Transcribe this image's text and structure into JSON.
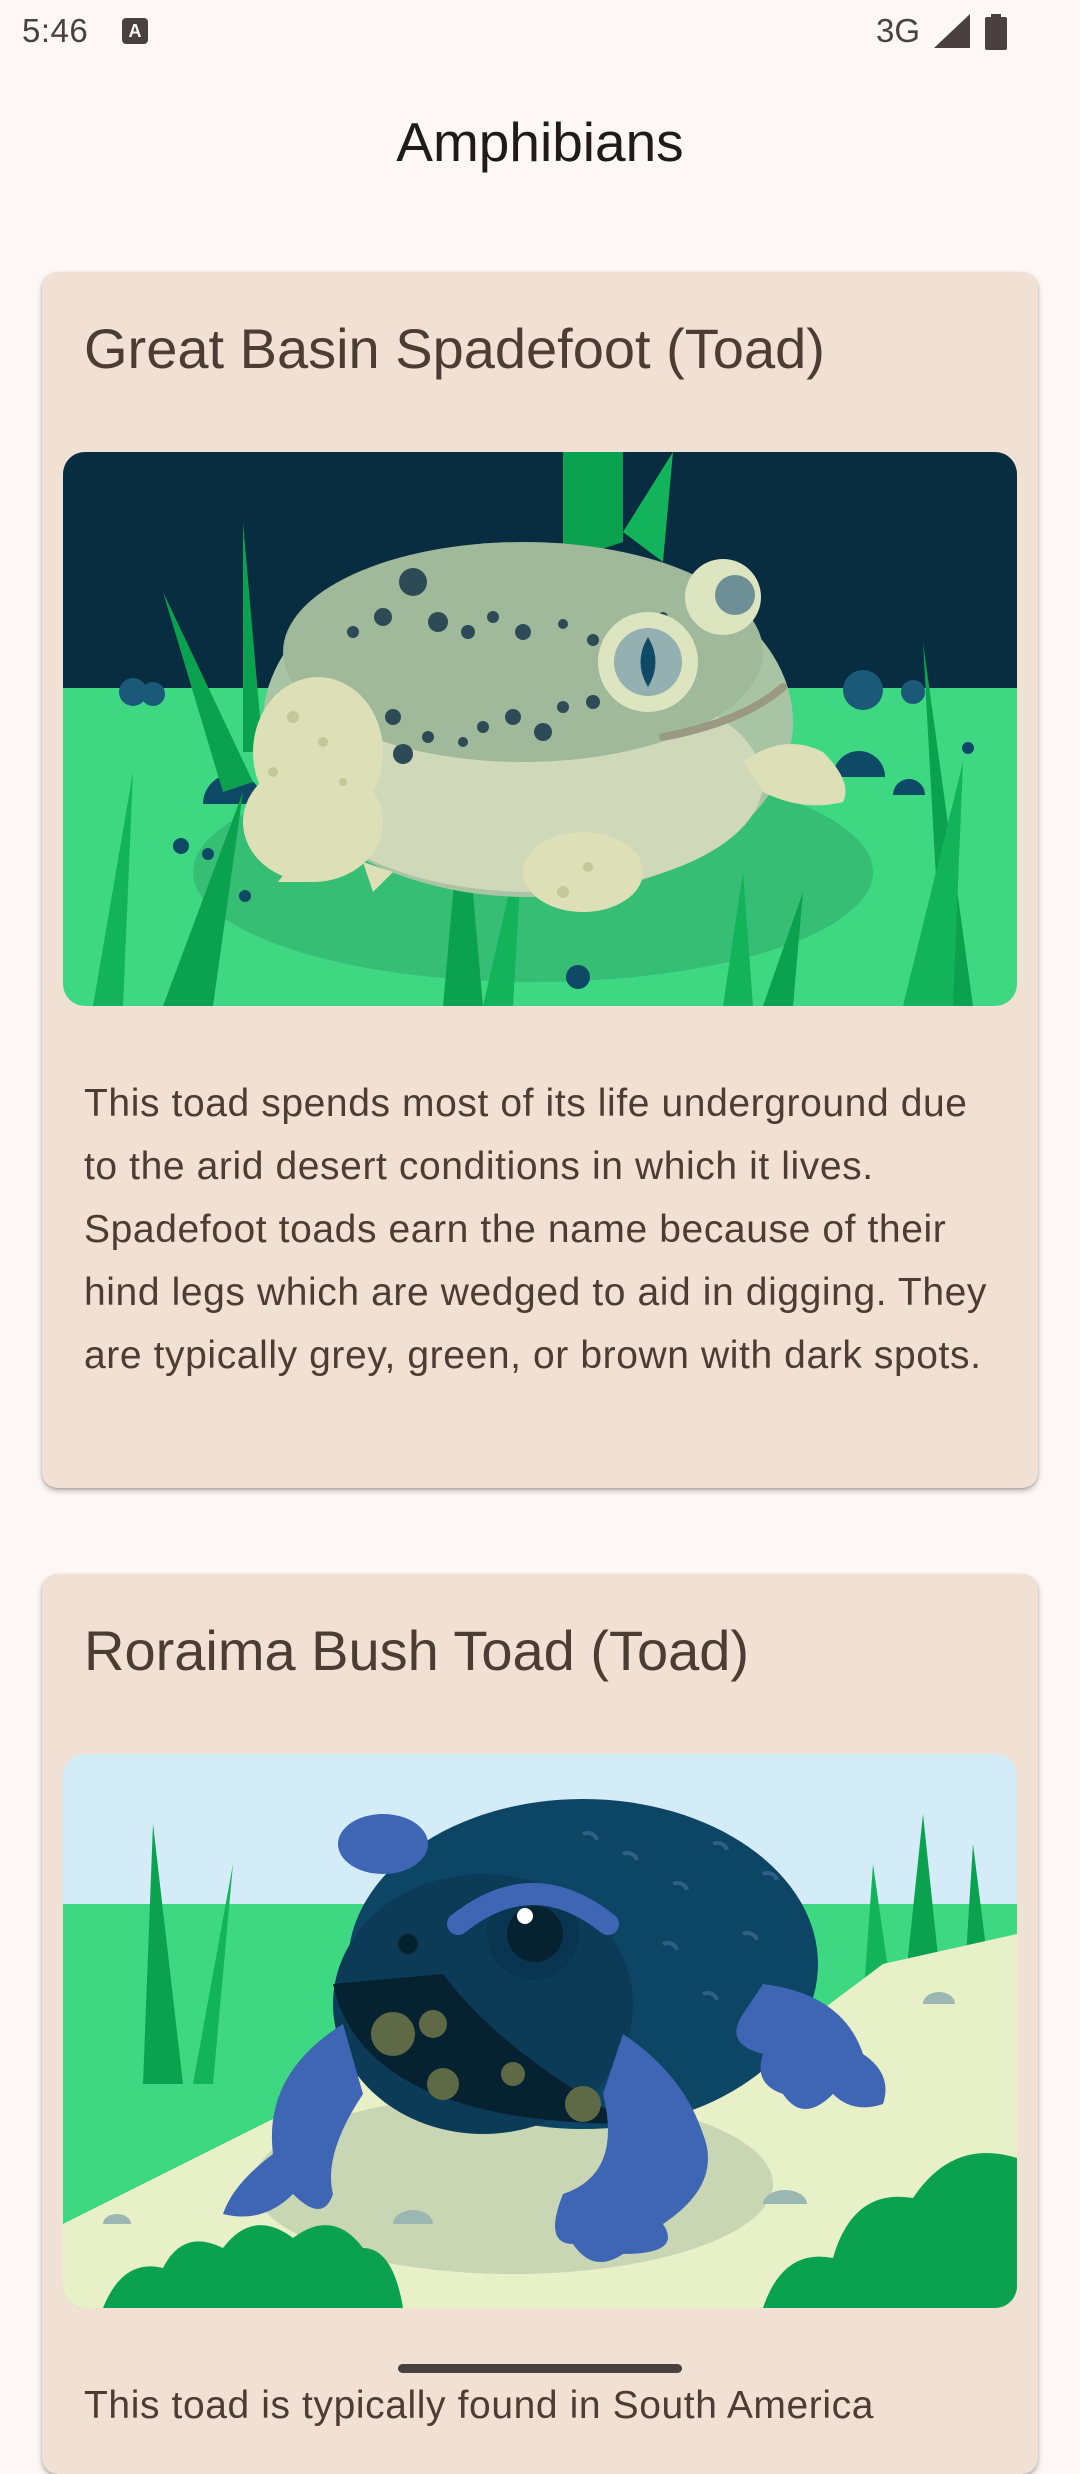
{
  "status_bar": {
    "time": "5:46",
    "notification_glyph": "A",
    "network": "3G",
    "icons": [
      "signal-icon",
      "battery-icon"
    ]
  },
  "app": {
    "title": "Amphibians"
  },
  "cards": [
    {
      "title": "Great Basin Spadefoot (Toad)",
      "image_name": "great-basin-spadefoot-illustration",
      "description": "This toad spends most of its life underground due to the arid desert conditions in which it lives. Spadefoot toads earn the name because of their hind legs which are wedged to aid in digging. They are typically grey, green, or brown with dark spots."
    },
    {
      "title": "Roraima Bush Toad (Toad)",
      "image_name": "roraima-bush-toad-illustration",
      "description": "This toad is typically found in South America"
    }
  ],
  "colors": {
    "background": "#fdf7f5",
    "card": "#f1e0d4",
    "text": "#4b3d33"
  }
}
